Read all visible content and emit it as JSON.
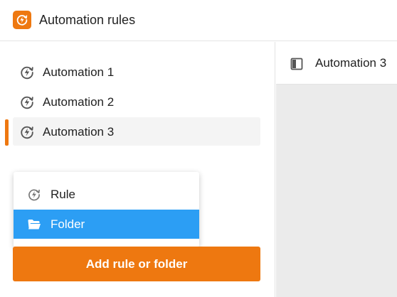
{
  "app": {
    "title": "Automation rules",
    "logo_icon": "automation-bolt-icon",
    "accent_color": "#ee7810"
  },
  "sidebar": {
    "items": [
      {
        "label": "Automation 1",
        "icon": "automation-bolt-icon",
        "selected": false
      },
      {
        "label": "Automation 2",
        "icon": "automation-bolt-icon",
        "selected": false
      },
      {
        "label": "Automation 3",
        "icon": "automation-bolt-icon",
        "selected": true
      }
    ]
  },
  "main": {
    "toggle_icon": "panel-toggle-icon",
    "title": "Automation 3"
  },
  "add_menu": {
    "items": [
      {
        "label": "Rule",
        "icon": "automation-bolt-icon",
        "highlighted": false
      },
      {
        "label": "Folder",
        "icon": "folder-icon",
        "highlighted": true
      }
    ],
    "highlight_color": "#2c9ef4"
  },
  "add_button": {
    "label": "Add rule or folder"
  }
}
